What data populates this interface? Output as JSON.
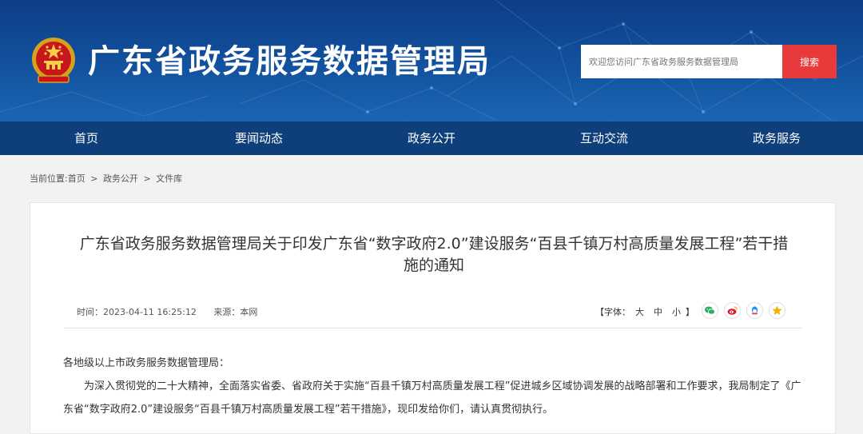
{
  "header": {
    "site_title": "广东省政务服务数据管理局",
    "search_placeholder": "欢迎您访问广东省政务服务数据管理局",
    "search_button": "搜索"
  },
  "nav": {
    "items": [
      {
        "label": "首页"
      },
      {
        "label": "要闻动态"
      },
      {
        "label": "政务公开"
      },
      {
        "label": "互动交流"
      },
      {
        "label": "政务服务"
      }
    ]
  },
  "breadcrumb": {
    "prefix": "当前位置:",
    "items": [
      "首页",
      ">",
      "政务公开",
      ">",
      "文件库"
    ]
  },
  "article": {
    "title": "广东省政务服务数据管理局关于印发广东省“数字政府2.0”建设服务“百县千镇万村高质量发展工程”若干措施的通知",
    "time": "时间：2023-04-11 16:25:12",
    "source": "来源：本网",
    "font_label": "【字体：",
    "font_large": "大",
    "font_medium": "中",
    "font_small": "小",
    "font_close": "】",
    "salutation": "各地级以上市政务服务数据管理局：",
    "paragraph": "为深入贯彻党的二十大精神，全面落实省委、省政府关于实施“百县千镇万村高质量发展工程”促进城乡区域协调发展的战略部署和工作要求，我局制定了《广东省“数字政府2.0”建设服务“百县千镇万村高质量发展工程”若干措施》，现印发给你们，请认真贯彻执行。"
  },
  "share_icons": [
    "wechat-icon",
    "weibo-icon",
    "qq-icon",
    "qzone-icon"
  ],
  "colors": {
    "header_blue": "#12529e",
    "nav_blue": "#0e3f7a",
    "search_red": "#e8393b",
    "wechat": "#2aae67",
    "weibo": "#e6162d",
    "qq": "#1e90ff",
    "qzone": "#f5b300"
  }
}
